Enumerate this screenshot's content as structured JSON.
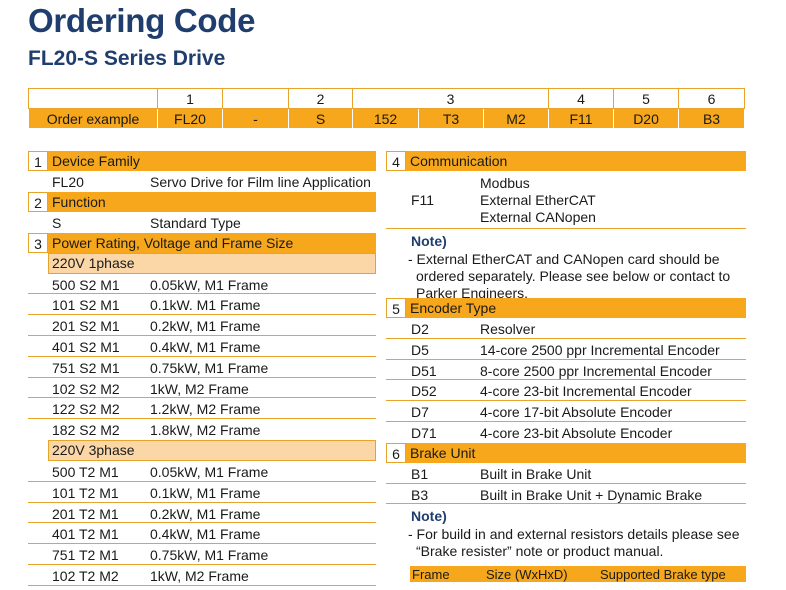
{
  "title": "Ordering Code",
  "subtitle": "FL20-S Series Drive",
  "order_table": {
    "numbers": [
      "",
      "1",
      "",
      "2",
      "3",
      "",
      "4",
      "5",
      "6"
    ],
    "example": [
      "Order example",
      "FL20",
      "-",
      "S",
      "152",
      "T3",
      "M2",
      "F11",
      "D20",
      "B3"
    ]
  },
  "sections": {
    "device_family": {
      "num": "1",
      "title": "Device Family",
      "rows": [
        {
          "code": "FL20",
          "desc": "Servo Drive for Film line Application"
        }
      ]
    },
    "function": {
      "num": "2",
      "title": "Function",
      "rows": [
        {
          "code": "S",
          "desc": "Standard Type"
        }
      ]
    },
    "power": {
      "num": "3",
      "title": "Power Rating, Voltage and Frame Size",
      "group1": "220V 1phase",
      "rows1": [
        {
          "code": "500 S2 M1",
          "desc": "0.05kW,  M1 Frame"
        },
        {
          "code": "101 S2 M1",
          "desc": "0.1kW. M1 Frame"
        },
        {
          "code": "201 S2 M1",
          "desc": "0.2kW, M1 Frame"
        },
        {
          "code": "401 S2 M1",
          "desc": "0.4kW,  M1 Frame"
        },
        {
          "code": "751 S2 M1",
          "desc": "0.75kW,  M1 Frame"
        },
        {
          "code": "102 S2 M2",
          "desc": "1kW,  M2 Frame"
        },
        {
          "code": "122 S2 M2",
          "desc": "1.2kW,  M2 Frame"
        },
        {
          "code": "182 S2 M2",
          "desc": "1.8kW,  M2 Frame"
        }
      ],
      "group2": "220V 3phase",
      "rows2": [
        {
          "code": "500 T2 M1",
          "desc": "0.05kW, M1 Frame"
        },
        {
          "code": "101 T2 M1",
          "desc": "0.1kW,  M1 Frame"
        },
        {
          "code": "201 T2 M1",
          "desc": "0.2kW,  M1 Frame"
        },
        {
          "code": "401 T2 M1",
          "desc": "0.4kW,  M1 Frame"
        },
        {
          "code": "751 T2 M1",
          "desc": "0.75kW,  M1 Frame"
        },
        {
          "code": "102 T2 M2",
          "desc": "1kW,  M2 Frame"
        }
      ]
    },
    "communication": {
      "num": "4",
      "title": "Communication",
      "code": "F11",
      "lines": [
        "Modbus",
        "External EtherCAT",
        "External CANopen"
      ],
      "note_title": "Note)",
      "note": "- External EtherCAT and CANopen card should be ordered  separately. Please see below or contact to Parker Engineers."
    },
    "encoder": {
      "num": "5",
      "title": "Encoder Type",
      "rows": [
        {
          "code": "D2",
          "desc": "Resolver"
        },
        {
          "code": "D5",
          "desc": "14-core 2500 ppr Incremental Encoder"
        },
        {
          "code": "D51",
          "desc": "8-core 2500 ppr Incremental Encoder"
        },
        {
          "code": "D52",
          "desc": "4-core 23-bit Incremental Encoder"
        },
        {
          "code": "D7",
          "desc": "4-core 17-bit Absolute Encoder"
        },
        {
          "code": "D71",
          "desc": "4-core 23-bit Absolute Encoder"
        }
      ]
    },
    "brake": {
      "num": "6",
      "title": "Brake Unit",
      "rows": [
        {
          "code": "B1",
          "desc": "Built in Brake Unit"
        },
        {
          "code": "B3",
          "desc": "Built in Brake Unit + Dynamic Brake"
        }
      ],
      "note_title": "Note)",
      "note": "- For build in and external resistors details please see “Brake resister” note or product manual.",
      "table_headers": [
        "Frame",
        "Size (WxHxD)",
        "Supported Brake type"
      ]
    }
  }
}
